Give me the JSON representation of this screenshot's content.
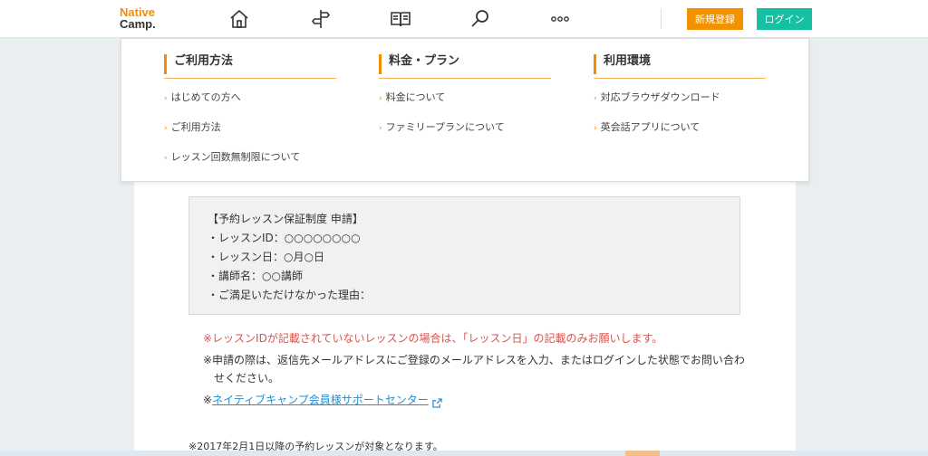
{
  "header": {
    "logo_line1": "Native",
    "logo_line2": "Camp.",
    "icons": [
      "home-icon",
      "signpost-icon",
      "book-icon",
      "search-icon",
      "more-icon"
    ],
    "register_label": "新規登録",
    "login_label": "ログイン",
    "accent_orange": "#f29200",
    "accent_teal": "#16c0a3"
  },
  "dropdown": {
    "columns": [
      {
        "heading": "ご利用方法",
        "items": [
          "はじめての方へ",
          "ご利用方法",
          "レッスン回数無制限について"
        ]
      },
      {
        "heading": "料金・プラン",
        "items": [
          "料金について",
          "ファミリープランについて"
        ]
      },
      {
        "heading": "利用環境",
        "items": [
          "対応ブラウザダウンロード",
          "英会話アプリについて"
        ]
      }
    ]
  },
  "content": {
    "apply_box": {
      "title": "【予約レッスン保証制度 申請】",
      "lines": [
        "・レッスンID：○○○○○○○○",
        "・レッスン日：○月○日",
        "・講師名：○○講師",
        "・ご満足いただけなかった理由："
      ]
    },
    "note_red": "※レッスンIDが記載されていないレッスンの場合は、「レッスン日」の記載のみお願いします。",
    "note_apply": "※申請の際は、返信先メールアドレスにご登録のメールアドレスを入力、またはログインした状態でお問い合わせください。",
    "note_link_prefix": "※",
    "note_link_text": "ネイティブキャンプ会員様サポートセンター",
    "footnote": "※2017年2月1日以降の予約レッスンが対象となります。"
  }
}
